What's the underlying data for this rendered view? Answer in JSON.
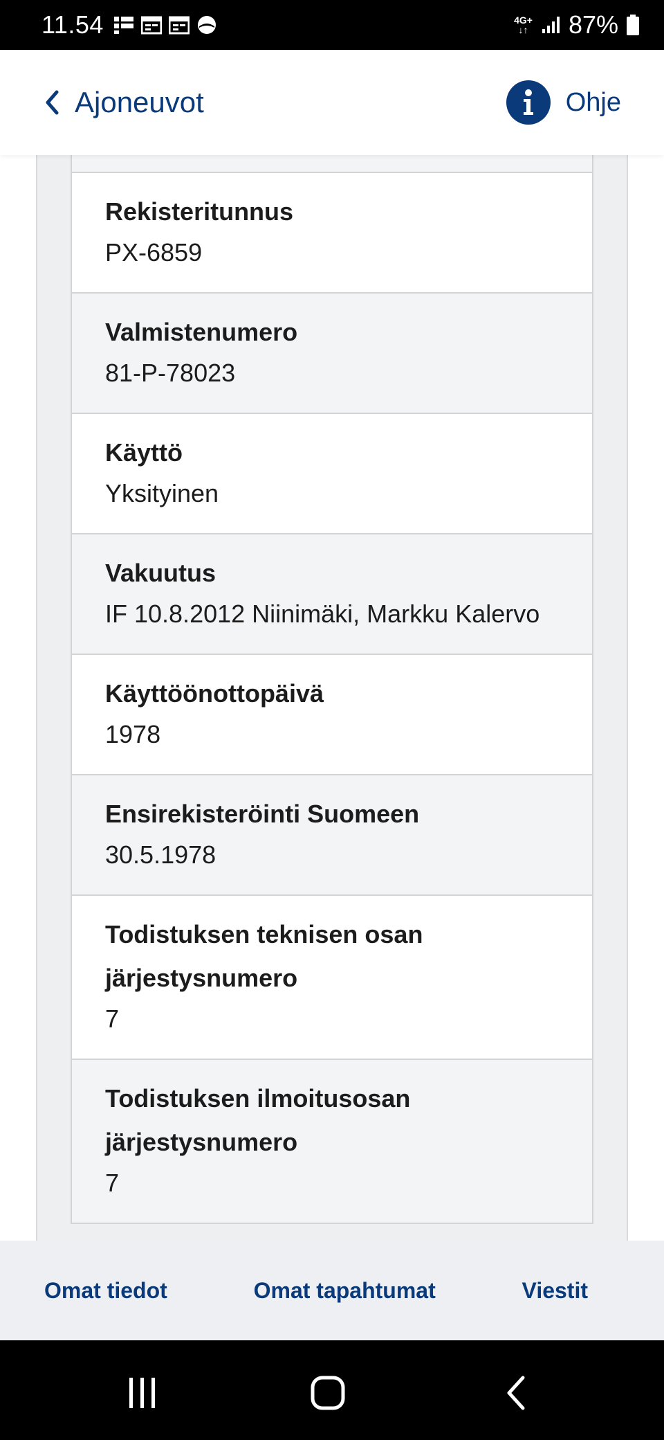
{
  "status_bar": {
    "time": "11.54",
    "network": "4G+",
    "battery": "87%",
    "icons": [
      "notification-grid-icon",
      "calendar-icon",
      "calendar-icon",
      "circle-app-icon",
      "signal-icon",
      "battery-icon"
    ]
  },
  "header": {
    "back_label": "Ajoneuvot",
    "help_label": "Ohje",
    "accent_color": "#0a3a7a"
  },
  "details": [
    {
      "label": "Rekisteritunnus",
      "value": "PX-6859"
    },
    {
      "label": "Valmistenumero",
      "value": "81-P-78023"
    },
    {
      "label": "Käyttö",
      "value": "Yksityinen"
    },
    {
      "label": "Vakuutus",
      "value": "IF 10.8.2012 Niinimäki, Markku Kalervo"
    },
    {
      "label": "Käyttöönottopäivä",
      "value": "1978"
    },
    {
      "label": "Ensirekisteröinti Suomeen",
      "value": "30.5.1978"
    },
    {
      "label": "Todistuksen teknisen osan järjestysnumero",
      "value": "7"
    },
    {
      "label": "Todistuksen ilmoitusosan järjestysnumero",
      "value": "7"
    }
  ],
  "bottom_nav": {
    "items": [
      "Omat tiedot",
      "Omat tapahtumat",
      "Viestit"
    ]
  }
}
